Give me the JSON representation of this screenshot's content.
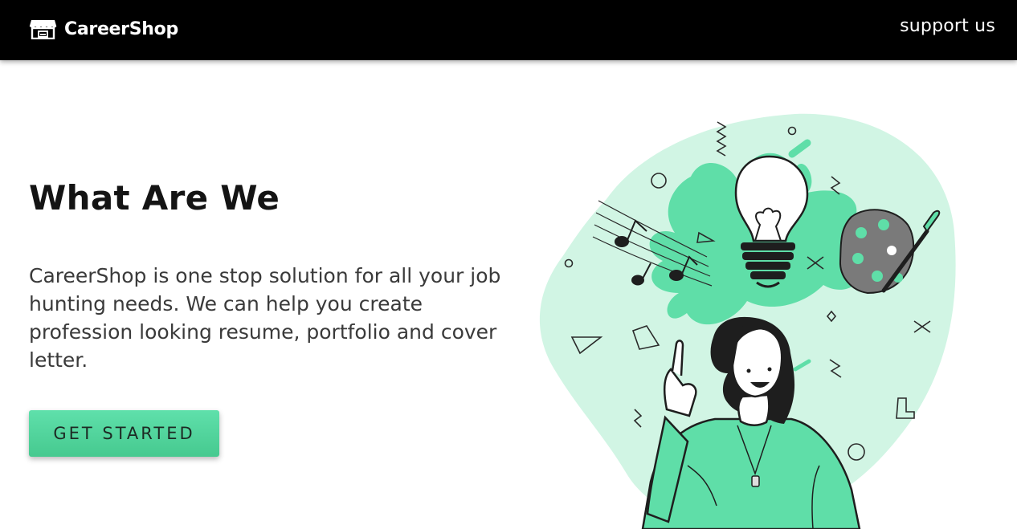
{
  "navbar": {
    "brand_name": "CareerShop",
    "brand_icon": "storefront-icon",
    "support_label": "support us",
    "background": "#000000"
  },
  "hero": {
    "title": "What Are We",
    "description": "CareerShop is one stop solution for all your job hunting needs. We can help you create profession looking resume, portfolio and cover letter.",
    "cta_label": "GET STARTED",
    "accent_color": "#52d69e"
  },
  "illustration": {
    "subject": "creative-woman-with-ideas-illustration",
    "icons": [
      "lightbulb-icon",
      "music-notes-icon",
      "paint-palette-icon",
      "paintbrush-icon"
    ]
  }
}
